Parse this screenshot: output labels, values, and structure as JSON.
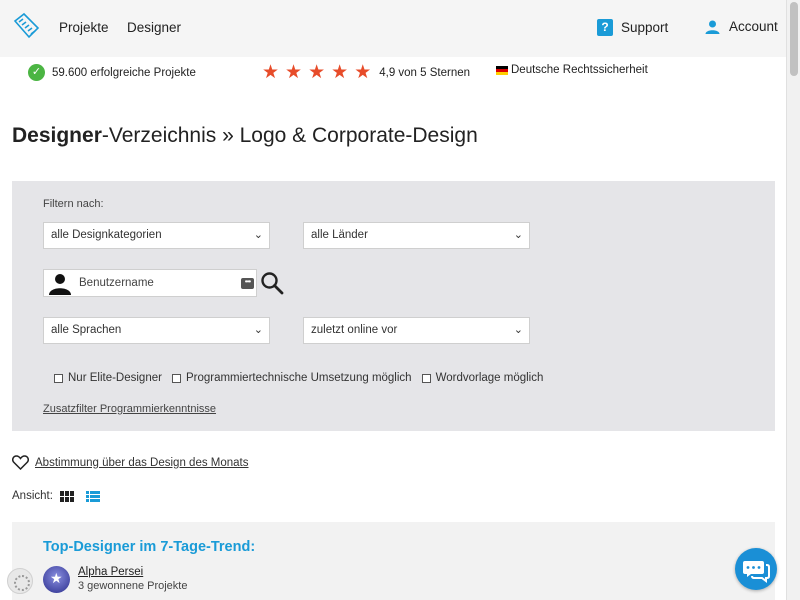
{
  "header": {
    "nav": {
      "projekte": "Projekte",
      "designer": "Designer"
    },
    "support_label": "Support",
    "support_icon": "?",
    "account_label": "Account"
  },
  "trust": {
    "projects": "59.600 erfolgreiche Projekte",
    "rating": "4,9 von 5 Sternen",
    "stars": 5,
    "legal": "Deutsche Rechtssicherheit"
  },
  "title": {
    "bold": "Designer",
    "rest": "-Verzeichnis » Logo & Corporate-Design"
  },
  "filter": {
    "label": "Filtern nach:",
    "category": "alle Designkategorien",
    "country": "alle Länder",
    "username_placeholder": "Benutzername",
    "language": "alle Sprachen",
    "online": "zuletzt online vor",
    "checkbox_elite": "Nur Elite-Designer",
    "checkbox_programming": "Programmiertechnische Umsetzung möglich",
    "checkbox_word": "Wordvorlage möglich",
    "extra_filter": "Zusatzfilter Programmierkenntnisse"
  },
  "vote_link": "Abstimmung über das Design des Monats",
  "view_label": "Ansicht:",
  "trend": {
    "title": "Top-Designer im 7-Tage-Trend:",
    "designer_name": "Alpha Persei",
    "designer_meta": "3 gewonnene Projekte"
  },
  "colors": {
    "accent": "#1a9bd7",
    "star": "#e74c2a",
    "success": "#4bb543",
    "panel": "#e5e5e8"
  }
}
